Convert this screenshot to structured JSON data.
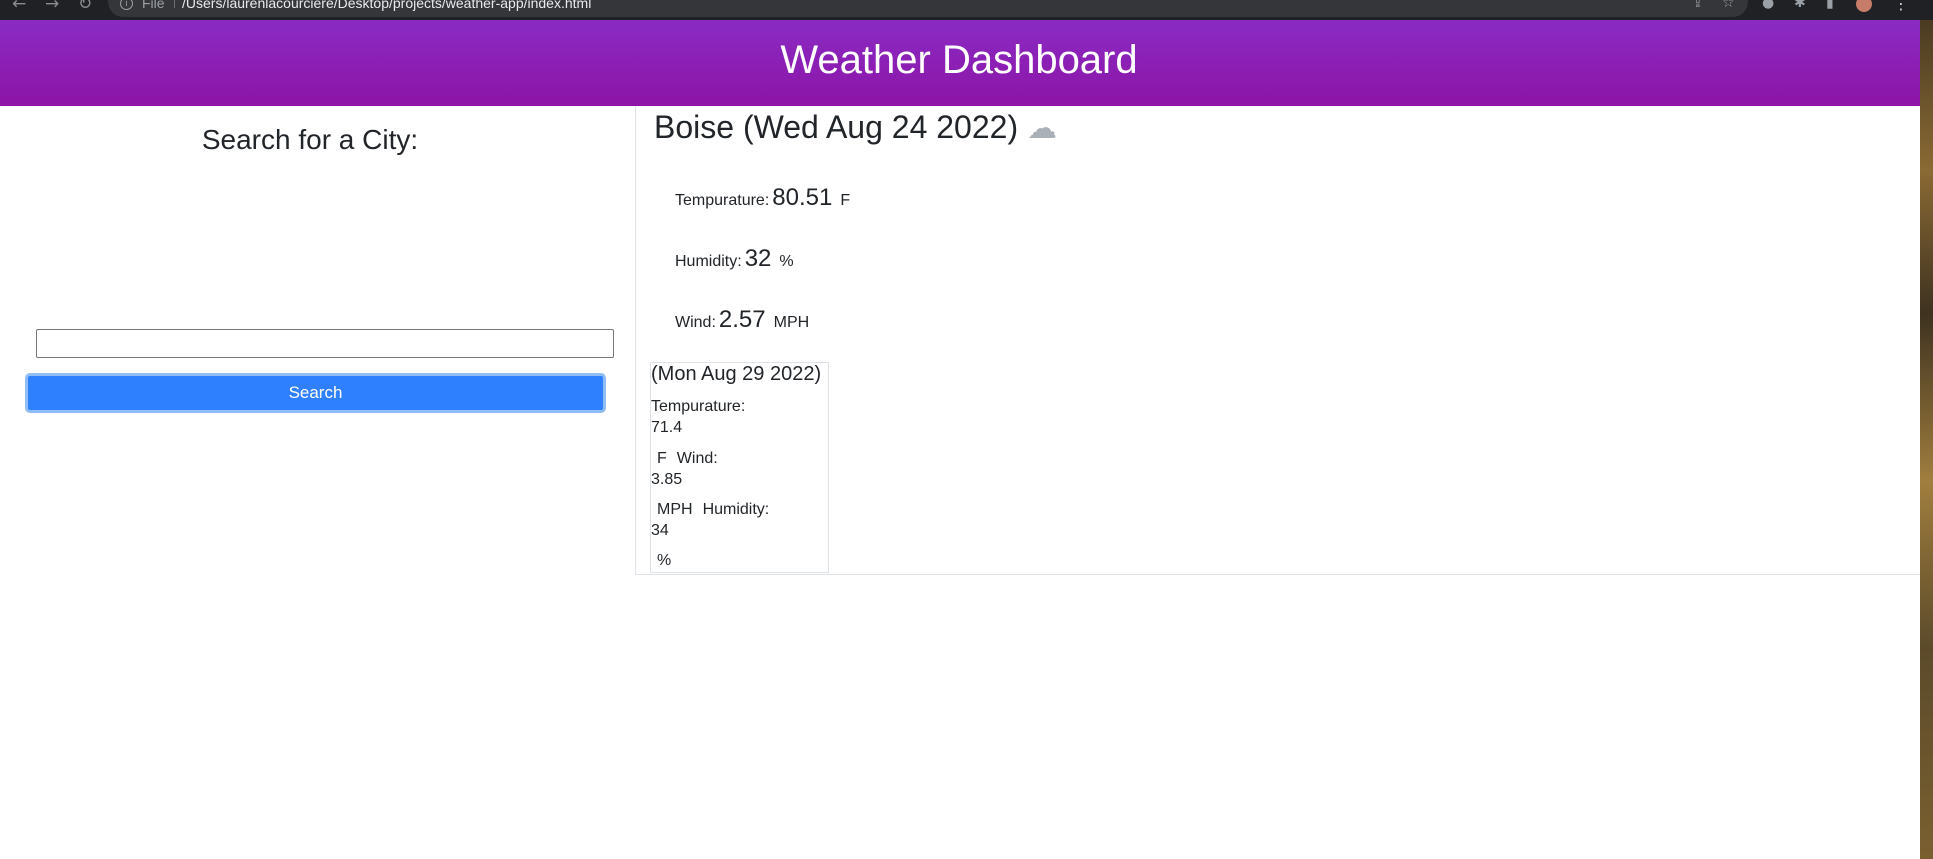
{
  "browser": {
    "file_label": "File",
    "url": "/Users/laurenlacourciere/Desktop/projects/weather-app/index.html"
  },
  "header": {
    "title": "Weather Dashboard"
  },
  "search": {
    "title": "Search for a City:",
    "input_value": "",
    "button_label": "Search"
  },
  "current": {
    "title": "Boise (Wed Aug 24 2022)",
    "icon": "cloud-icon",
    "temperature": {
      "label": "Tempurature:",
      "value": "80.51",
      "unit": "F"
    },
    "humidity": {
      "label": "Humidity:",
      "value": "32",
      "unit": "%"
    },
    "wind": {
      "label": "Wind:",
      "value": "2.57",
      "unit": "MPH"
    }
  },
  "forecast": [
    {
      "date": "(Mon Aug 29 2022)",
      "temp_label": "Tempurature:",
      "temp_value": "71.4",
      "temp_unit": "F",
      "wind_label": "Wind:",
      "wind_value": "3.85",
      "wind_unit": "MPH",
      "humidity_label": "Humidity:",
      "humidity_value": "34",
      "humidity_unit": "%"
    }
  ],
  "colors": {
    "header_gradient_top": "#8a2bc4",
    "header_gradient_bottom": "#8d14a6",
    "button_primary": "#2f80ff"
  }
}
